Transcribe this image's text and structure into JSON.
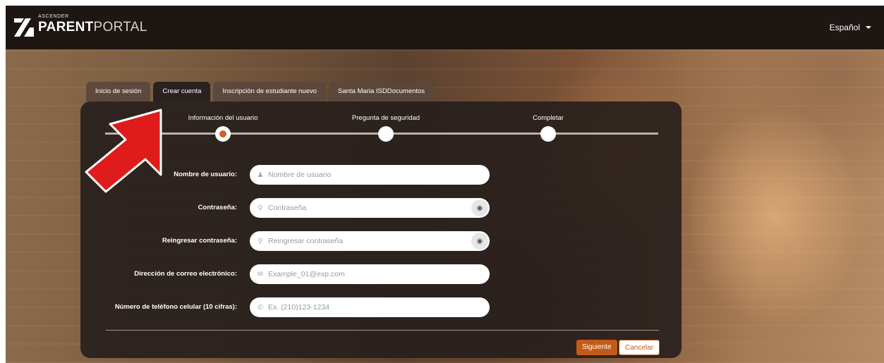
{
  "header": {
    "logo_small": "ASCENDER",
    "logo_bold": "PARENT",
    "logo_light": "PORTAL",
    "language": "Español"
  },
  "tabs": [
    {
      "label": "Inicio de sesión",
      "active": false
    },
    {
      "label": "Crear cuenta",
      "active": true
    },
    {
      "label": "Inscripción de estudiante nuevo",
      "active": false
    },
    {
      "label": "Santa Maria ISDDocumentos",
      "active": false
    }
  ],
  "steps": [
    {
      "label": "Información del usuario",
      "current": true
    },
    {
      "label": "Pregunta de seguridad",
      "current": false
    },
    {
      "label": "Completar",
      "current": false
    }
  ],
  "form": {
    "username": {
      "label": "Nombre de usuario:",
      "placeholder": "Nombre de usuario",
      "value": "",
      "icon": "user-icon"
    },
    "password": {
      "label": "Contraseña:",
      "placeholder": "Contraseña",
      "value": "",
      "icon": "key-icon"
    },
    "password_confirm": {
      "label": "Reingresar contraseña:",
      "placeholder": "Reingresar contraseña",
      "value": "",
      "icon": "key-icon"
    },
    "email": {
      "label": "Dirección de correo electrónico:",
      "placeholder": "Example_01@exp.com",
      "value": "",
      "icon": "envelope-icon"
    },
    "phone": {
      "label": "Número de teléfono celular (10 cifras):",
      "placeholder": "Ex. (210)123-1234",
      "value": "",
      "icon": "phone-icon"
    }
  },
  "buttons": {
    "next": "Siguiente",
    "cancel": "Cancelar"
  },
  "colors": {
    "accent": "#c35a17",
    "header_bg": "#1d1612",
    "panel_bg": "#261e1c",
    "arrow": "#e01b1b"
  }
}
